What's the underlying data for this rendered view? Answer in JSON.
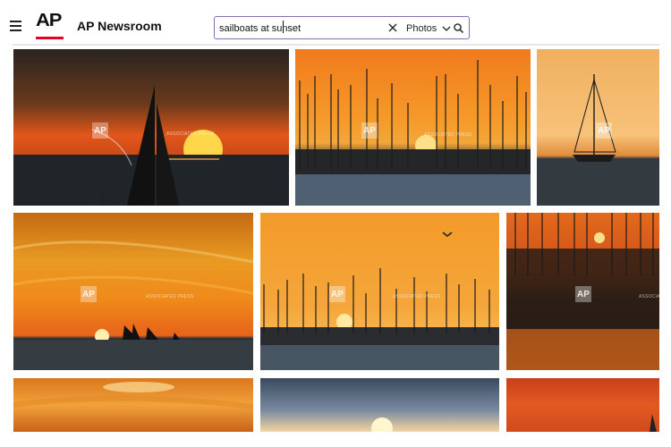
{
  "header": {
    "brand": "AP Newsroom",
    "logo_text": "AP",
    "menu_icon": "hamburger-menu-icon"
  },
  "search": {
    "query": "sailboats at sunset",
    "type_label": "Photos",
    "clear_icon": "close-icon",
    "dropdown_icon": "chevron-down-icon",
    "search_icon": "search-icon"
  },
  "watermark": {
    "logo": "AP",
    "text": "ASSOCIATED PRESS"
  },
  "colors": {
    "search_border": "#8b6ab6",
    "logo_red": "#e4002b"
  },
  "results": [
    {
      "id": "r1"
    },
    {
      "id": "r2"
    },
    {
      "id": "r3"
    },
    {
      "id": "r4"
    },
    {
      "id": "r5"
    },
    {
      "id": "r6"
    },
    {
      "id": "r7"
    },
    {
      "id": "r8"
    },
    {
      "id": "r9"
    }
  ]
}
